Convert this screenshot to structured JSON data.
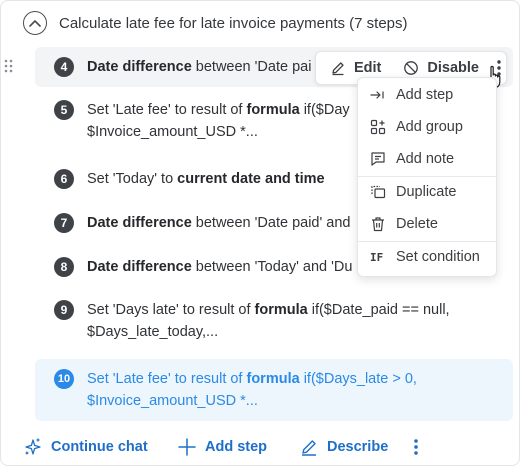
{
  "header": {
    "title": "Calculate late fee for late invoice payments (7 steps)"
  },
  "steps": [
    {
      "number": "4",
      "lead": "",
      "bold": "Date difference",
      "rest": " between 'Date pai"
    },
    {
      "number": "5",
      "lead": "Set 'Late fee' to result of ",
      "bold": "formula",
      "rest": " if($Day",
      "line2": "$Invoice_amount_USD *..."
    },
    {
      "number": "6",
      "lead": "Set 'Today' to ",
      "bold": "current date and time",
      "rest": ""
    },
    {
      "number": "7",
      "lead": "",
      "bold": "Date difference",
      "rest": " between 'Date paid' and"
    },
    {
      "number": "8",
      "lead": "",
      "bold": "Date difference",
      "rest": " between 'Today' and 'Du"
    },
    {
      "number": "9",
      "lead": "Set 'Days late' to result of ",
      "bold": "formula",
      "rest": " if($Date_paid == null,",
      "line2": "$Days_late_today,..."
    },
    {
      "number": "10",
      "lead": "Set 'Late fee' to result of ",
      "bold": "formula",
      "rest": " if($Days_late > 0,",
      "line2": "$Invoice_amount_USD *..."
    }
  ],
  "toolbar": {
    "edit_label": "Edit",
    "disable_label": "Disable"
  },
  "menu": {
    "items": [
      {
        "label": "Add step",
        "icon": "add-step-icon"
      },
      {
        "label": "Add group",
        "icon": "add-group-icon"
      },
      {
        "label": "Add note",
        "icon": "add-note-icon"
      },
      {
        "label": "Duplicate",
        "icon": "duplicate-icon"
      },
      {
        "label": "Delete",
        "icon": "trash-icon"
      },
      {
        "label": "Set condition",
        "icon": "if-condition-icon",
        "icon_text": "IF"
      }
    ]
  },
  "footer": {
    "continue_chat": "Continue chat",
    "add_step": "Add step",
    "describe": "Describe"
  },
  "colors": {
    "accent": "#2a8ae6",
    "link": "#1f6fc9",
    "active_bg": "#eef6fd",
    "hover_bg": "#f3f4f6"
  }
}
